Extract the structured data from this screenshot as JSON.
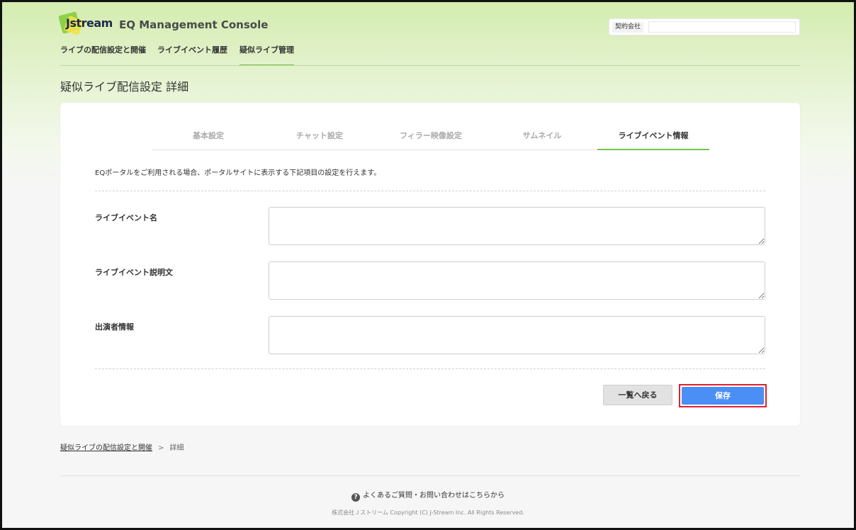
{
  "header": {
    "logo_text": "Jstream",
    "app_title": "EQ Management Console",
    "contract_label": "契約会社",
    "contract_value": ""
  },
  "topnav": {
    "items": [
      {
        "label": "ライブの配信設定と開催",
        "active": false
      },
      {
        "label": "ライブイベント履歴",
        "active": false
      },
      {
        "label": "疑似ライブ管理",
        "active": true
      }
    ]
  },
  "page_title": "疑似ライブ配信設定 詳細",
  "tabs": [
    {
      "label": "基本設定",
      "active": false
    },
    {
      "label": "チャット設定",
      "active": false
    },
    {
      "label": "フィラー映像設定",
      "active": false
    },
    {
      "label": "サムネイル",
      "active": false
    },
    {
      "label": "ライブイベント情報",
      "active": true
    }
  ],
  "description": "EQポータルをご利用される場合、ポータルサイトに表示する下記項目の設定を行えます。",
  "fields": [
    {
      "label": "ライブイベント名",
      "value": ""
    },
    {
      "label": "ライブイベント説明文",
      "value": ""
    },
    {
      "label": "出演者情報",
      "value": ""
    }
  ],
  "buttons": {
    "back": "一覧へ戻る",
    "save": "保存"
  },
  "breadcrumb": {
    "parent": "疑似ライブの配信設定と開催",
    "separator": ">",
    "current": "詳細"
  },
  "footer": {
    "faq": "よくあるご質問・お問い合わせはこちらから",
    "help_icon_glyph": "?",
    "copyright": "株式会社Ｊストリーム Copyright (C) J-Stream Inc. All Rights Reserved."
  },
  "colors": {
    "accent_green": "#7cc046",
    "save_blue": "#4b8ef5",
    "highlight_red": "#e0202a"
  }
}
